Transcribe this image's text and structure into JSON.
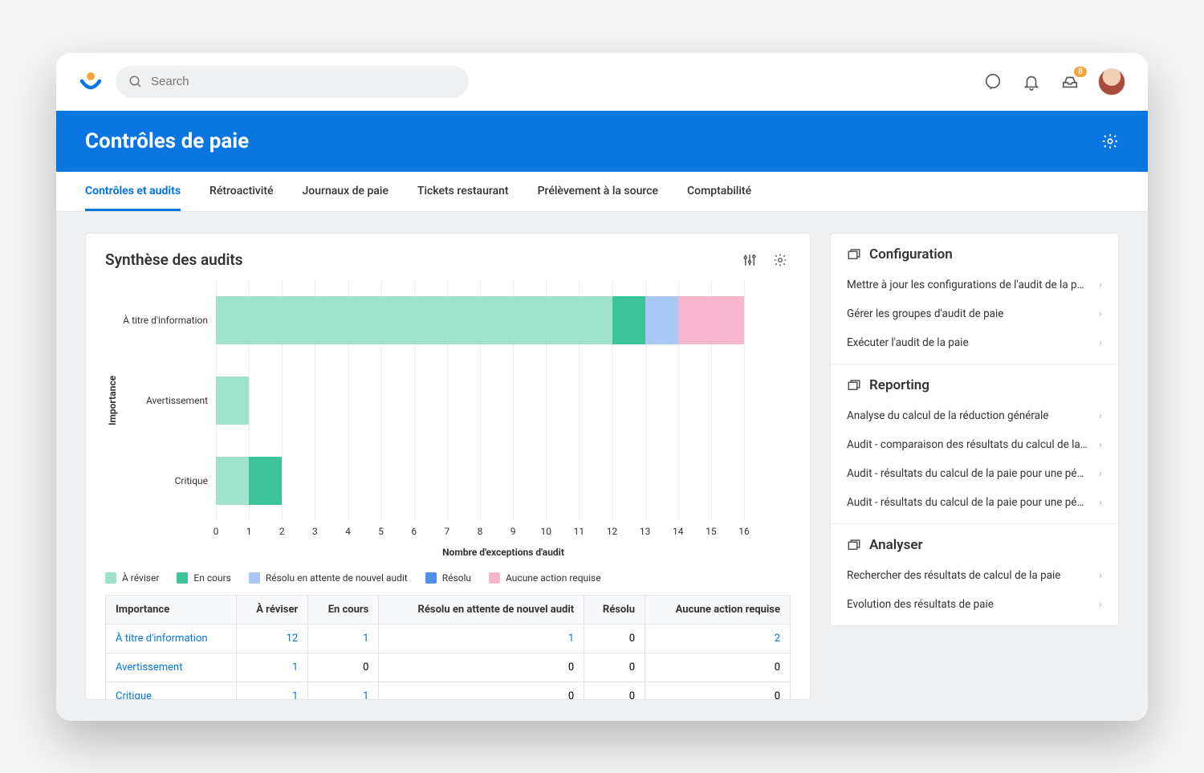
{
  "search": {
    "placeholder": "Search"
  },
  "notifications": {
    "badge": "8"
  },
  "page": {
    "title": "Contrôles de paie"
  },
  "tabs": [
    {
      "label": "Contrôles et audits",
      "active": true
    },
    {
      "label": "Rétroactivité"
    },
    {
      "label": "Journaux de paie"
    },
    {
      "label": "Tickets restaurant"
    },
    {
      "label": "Prélèvement à la source"
    },
    {
      "label": "Comptabilité"
    }
  ],
  "card": {
    "title": "Synthèse des audits"
  },
  "chart_data": {
    "type": "bar",
    "orientation": "horizontal-stacked",
    "ylabel": "Importance",
    "xlabel": "Nombre d'exceptions d'audit",
    "xticks": [
      0,
      1,
      2,
      3,
      4,
      5,
      6,
      7,
      8,
      9,
      10,
      11,
      12,
      13,
      14,
      15,
      16
    ],
    "categories": [
      "À titre d'information",
      "Avertissement",
      "Critique"
    ],
    "series": [
      {
        "name": "À réviser",
        "color": "#9fe3cd",
        "values": [
          12,
          1,
          1
        ]
      },
      {
        "name": "En cours",
        "color": "#3cc39a",
        "values": [
          1,
          0,
          1
        ]
      },
      {
        "name": "Résolu en attente de nouvel audit",
        "color": "#a9c8f5",
        "values": [
          1,
          0,
          0
        ]
      },
      {
        "name": "Résolu",
        "color": "#4f8fe8",
        "values": [
          0,
          0,
          0
        ]
      },
      {
        "name": "Aucune action requise",
        "color": "#f5b6ce",
        "values": [
          2,
          0,
          0
        ]
      }
    ]
  },
  "table": {
    "headers": [
      "Importance",
      "À réviser",
      "En cours",
      "Résolu en attente de nouvel audit",
      "Résolu",
      "Aucune action requise"
    ],
    "rows": [
      {
        "label": "À titre d'information",
        "cells": [
          "12",
          "1",
          "1",
          "0",
          "2"
        ],
        "linkCells": [
          true,
          true,
          true,
          false,
          true
        ]
      },
      {
        "label": "Avertissement",
        "cells": [
          "1",
          "0",
          "0",
          "0",
          "0"
        ],
        "linkCells": [
          true,
          false,
          false,
          false,
          false
        ]
      },
      {
        "label": "Critique",
        "cells": [
          "1",
          "1",
          "0",
          "0",
          "0"
        ],
        "linkCells": [
          true,
          true,
          false,
          false,
          false
        ]
      }
    ]
  },
  "sidebar": {
    "sections": [
      {
        "title": "Configuration",
        "links": [
          "Mettre à jour les configurations de l'audit de la paie",
          "Gérer les groupes d'audit de paie",
          "Exécuter l'audit de la paie"
        ]
      },
      {
        "title": "Reporting",
        "links": [
          "Analyse du calcul de la réduction générale",
          "Audit - comparaison des résultats du calcul de la pai...",
          "Audit - résultats du calcul de la paie pour une période",
          "Audit - résultats du calcul de la paie pour une périod..."
        ]
      },
      {
        "title": "Analyser",
        "links": [
          "Rechercher des résultats de calcul de la paie",
          "Evolution des résultats de paie"
        ]
      }
    ]
  }
}
